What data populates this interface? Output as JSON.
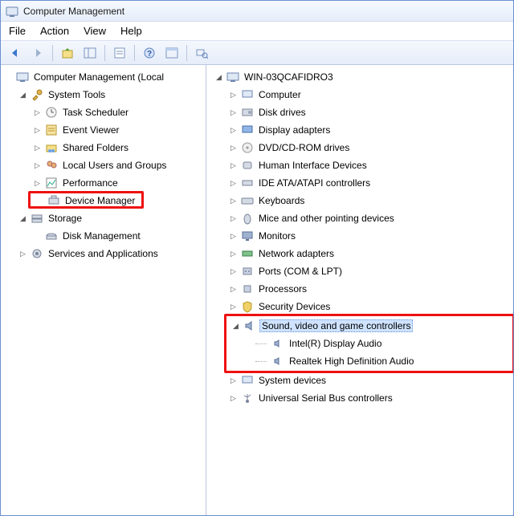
{
  "window": {
    "title": "Computer Management"
  },
  "menubar": {
    "file": "File",
    "action": "Action",
    "view": "View",
    "help": "Help"
  },
  "left": {
    "root": "Computer Management (Local",
    "systools": "System Tools",
    "task": "Task Scheduler",
    "eventv": "Event Viewer",
    "shared": "Shared Folders",
    "localusers": "Local Users and Groups",
    "perf": "Performance",
    "devmgr": "Device Manager",
    "storage": "Storage",
    "diskmgmt": "Disk Management",
    "services": "Services and Applications"
  },
  "right": {
    "root": "WIN-03QCAFIDRO3",
    "computer": "Computer",
    "disk": "Disk drives",
    "display": "Display adapters",
    "dvd": "DVD/CD-ROM drives",
    "hid": "Human Interface Devices",
    "ide": "IDE ATA/ATAPI controllers",
    "keyb": "Keyboards",
    "mice": "Mice and other pointing devices",
    "monitors": "Monitors",
    "netadapt": "Network adapters",
    "ports": "Ports (COM & LPT)",
    "proc": "Processors",
    "sec": "Security Devices",
    "sound": "Sound, video and game controllers",
    "sound_c1": "Intel(R) Display Audio",
    "sound_c2": "Realtek High Definition Audio",
    "sysdev": "System devices",
    "usb": "Universal Serial Bus controllers"
  }
}
